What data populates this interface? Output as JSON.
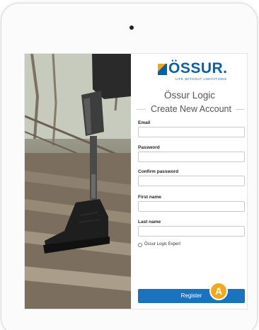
{
  "brand": {
    "name": "ÖSSUR.",
    "tagline": "LIFE WITHOUT LIMITATIONS"
  },
  "app": {
    "title": "Össur Logic",
    "subtitle": "Create New Account"
  },
  "form": {
    "fields": [
      {
        "label": "Email",
        "value": ""
      },
      {
        "label": "Password",
        "value": ""
      },
      {
        "label": "Confirm password",
        "value": ""
      },
      {
        "label": "First name",
        "value": ""
      },
      {
        "label": "Last name",
        "value": ""
      }
    ],
    "expert_option": "Össur Logic Expert",
    "register_label": "Register"
  },
  "annotation": {
    "badge": "A"
  },
  "colors": {
    "brand_blue": "#0b5fa5",
    "brand_orange": "#f2a71b",
    "button_blue": "#1b73bf"
  }
}
